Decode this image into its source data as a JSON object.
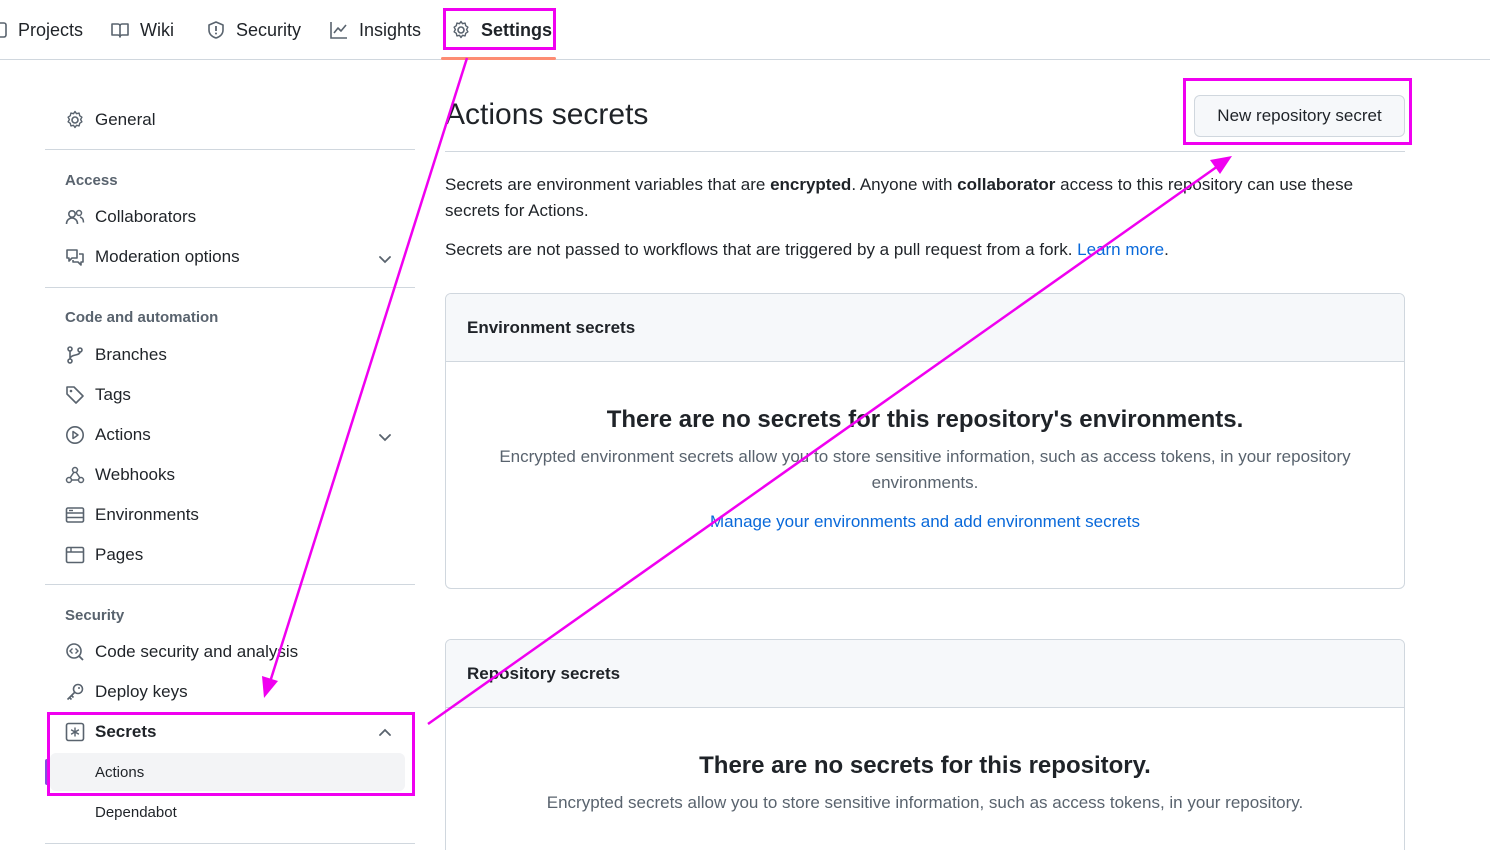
{
  "topnav": {
    "tabs": [
      {
        "label": "Projects",
        "icon": "table-icon"
      },
      {
        "label": "Wiki",
        "icon": "book-icon"
      },
      {
        "label": "Security",
        "icon": "shield-icon"
      },
      {
        "label": "Insights",
        "icon": "graph-icon"
      },
      {
        "label": "Settings",
        "icon": "gear-icon",
        "active": true
      }
    ]
  },
  "sidebar": {
    "general": "General",
    "sections": {
      "access": "Access",
      "code": "Code and automation",
      "security": "Security"
    },
    "items": {
      "collaborators": "Collaborators",
      "moderation": "Moderation options",
      "branches": "Branches",
      "tags": "Tags",
      "actions": "Actions",
      "webhooks": "Webhooks",
      "environments": "Environments",
      "pages": "Pages",
      "code_security": "Code security and analysis",
      "deploy_keys": "Deploy keys",
      "secrets": "Secrets"
    },
    "secrets_sub": {
      "actions": "Actions",
      "dependabot": "Dependabot"
    }
  },
  "main": {
    "title": "Actions secrets",
    "new_button": "New repository secret",
    "intro": {
      "t1": "Secrets are environment variables that are ",
      "b1": "encrypted",
      "t2": ". Anyone with ",
      "b2": "collaborator",
      "t3": " access to this repository can use these secrets for Actions."
    },
    "note": {
      "text": "Secrets are not passed to workflows that are triggered by a pull request from a fork. ",
      "link": "Learn more",
      "end": "."
    },
    "env_box": {
      "header": "Environment secrets",
      "blank_title": "There are no secrets for this repository's environments.",
      "blank_desc": "Encrypted environment secrets allow you to store sensitive information, such as access tokens, in your repository environments.",
      "blank_link": "Manage your environments and add environment secrets"
    },
    "repo_box": {
      "header": "Repository secrets",
      "blank_title": "There are no secrets for this repository.",
      "blank_desc": "Encrypted secrets allow you to store sensitive information, such as access tokens, in your repository."
    }
  },
  "colors": {
    "annotation": "#f000f0",
    "link": "#0969da",
    "active_tab_underline": "#fd8c73",
    "active_marker": "#8250df"
  }
}
